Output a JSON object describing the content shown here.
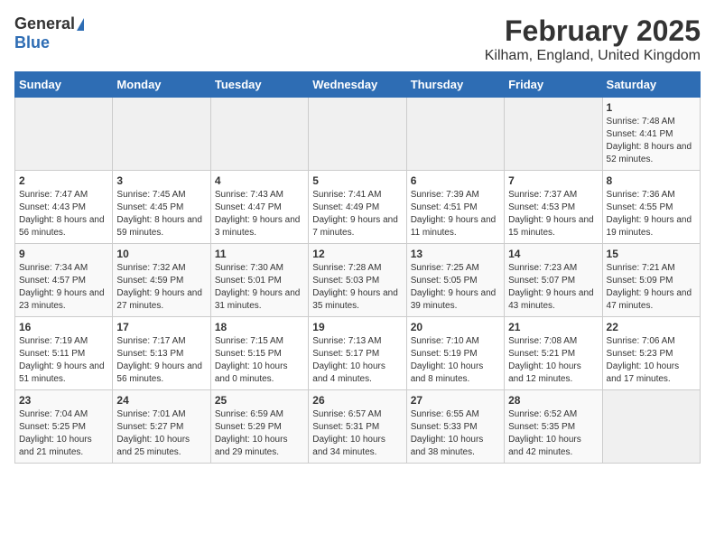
{
  "logo": {
    "general": "General",
    "blue": "Blue"
  },
  "title": "February 2025",
  "subtitle": "Kilham, England, United Kingdom",
  "days_of_week": [
    "Sunday",
    "Monday",
    "Tuesday",
    "Wednesday",
    "Thursday",
    "Friday",
    "Saturday"
  ],
  "weeks": [
    [
      {
        "day": "",
        "info": ""
      },
      {
        "day": "",
        "info": ""
      },
      {
        "day": "",
        "info": ""
      },
      {
        "day": "",
        "info": ""
      },
      {
        "day": "",
        "info": ""
      },
      {
        "day": "",
        "info": ""
      },
      {
        "day": "1",
        "info": "Sunrise: 7:48 AM\nSunset: 4:41 PM\nDaylight: 8 hours and 52 minutes."
      }
    ],
    [
      {
        "day": "2",
        "info": "Sunrise: 7:47 AM\nSunset: 4:43 PM\nDaylight: 8 hours and 56 minutes."
      },
      {
        "day": "3",
        "info": "Sunrise: 7:45 AM\nSunset: 4:45 PM\nDaylight: 8 hours and 59 minutes."
      },
      {
        "day": "4",
        "info": "Sunrise: 7:43 AM\nSunset: 4:47 PM\nDaylight: 9 hours and 3 minutes."
      },
      {
        "day": "5",
        "info": "Sunrise: 7:41 AM\nSunset: 4:49 PM\nDaylight: 9 hours and 7 minutes."
      },
      {
        "day": "6",
        "info": "Sunrise: 7:39 AM\nSunset: 4:51 PM\nDaylight: 9 hours and 11 minutes."
      },
      {
        "day": "7",
        "info": "Sunrise: 7:37 AM\nSunset: 4:53 PM\nDaylight: 9 hours and 15 minutes."
      },
      {
        "day": "8",
        "info": "Sunrise: 7:36 AM\nSunset: 4:55 PM\nDaylight: 9 hours and 19 minutes."
      }
    ],
    [
      {
        "day": "9",
        "info": "Sunrise: 7:34 AM\nSunset: 4:57 PM\nDaylight: 9 hours and 23 minutes."
      },
      {
        "day": "10",
        "info": "Sunrise: 7:32 AM\nSunset: 4:59 PM\nDaylight: 9 hours and 27 minutes."
      },
      {
        "day": "11",
        "info": "Sunrise: 7:30 AM\nSunset: 5:01 PM\nDaylight: 9 hours and 31 minutes."
      },
      {
        "day": "12",
        "info": "Sunrise: 7:28 AM\nSunset: 5:03 PM\nDaylight: 9 hours and 35 minutes."
      },
      {
        "day": "13",
        "info": "Sunrise: 7:25 AM\nSunset: 5:05 PM\nDaylight: 9 hours and 39 minutes."
      },
      {
        "day": "14",
        "info": "Sunrise: 7:23 AM\nSunset: 5:07 PM\nDaylight: 9 hours and 43 minutes."
      },
      {
        "day": "15",
        "info": "Sunrise: 7:21 AM\nSunset: 5:09 PM\nDaylight: 9 hours and 47 minutes."
      }
    ],
    [
      {
        "day": "16",
        "info": "Sunrise: 7:19 AM\nSunset: 5:11 PM\nDaylight: 9 hours and 51 minutes."
      },
      {
        "day": "17",
        "info": "Sunrise: 7:17 AM\nSunset: 5:13 PM\nDaylight: 9 hours and 56 minutes."
      },
      {
        "day": "18",
        "info": "Sunrise: 7:15 AM\nSunset: 5:15 PM\nDaylight: 10 hours and 0 minutes."
      },
      {
        "day": "19",
        "info": "Sunrise: 7:13 AM\nSunset: 5:17 PM\nDaylight: 10 hours and 4 minutes."
      },
      {
        "day": "20",
        "info": "Sunrise: 7:10 AM\nSunset: 5:19 PM\nDaylight: 10 hours and 8 minutes."
      },
      {
        "day": "21",
        "info": "Sunrise: 7:08 AM\nSunset: 5:21 PM\nDaylight: 10 hours and 12 minutes."
      },
      {
        "day": "22",
        "info": "Sunrise: 7:06 AM\nSunset: 5:23 PM\nDaylight: 10 hours and 17 minutes."
      }
    ],
    [
      {
        "day": "23",
        "info": "Sunrise: 7:04 AM\nSunset: 5:25 PM\nDaylight: 10 hours and 21 minutes."
      },
      {
        "day": "24",
        "info": "Sunrise: 7:01 AM\nSunset: 5:27 PM\nDaylight: 10 hours and 25 minutes."
      },
      {
        "day": "25",
        "info": "Sunrise: 6:59 AM\nSunset: 5:29 PM\nDaylight: 10 hours and 29 minutes."
      },
      {
        "day": "26",
        "info": "Sunrise: 6:57 AM\nSunset: 5:31 PM\nDaylight: 10 hours and 34 minutes."
      },
      {
        "day": "27",
        "info": "Sunrise: 6:55 AM\nSunset: 5:33 PM\nDaylight: 10 hours and 38 minutes."
      },
      {
        "day": "28",
        "info": "Sunrise: 6:52 AM\nSunset: 5:35 PM\nDaylight: 10 hours and 42 minutes."
      },
      {
        "day": "",
        "info": ""
      }
    ]
  ]
}
